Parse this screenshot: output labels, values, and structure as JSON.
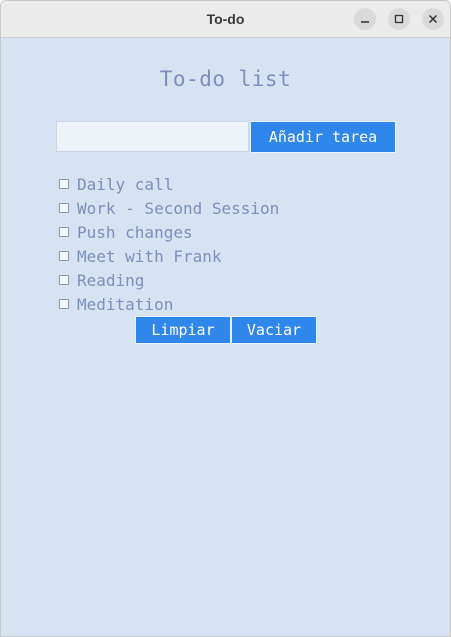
{
  "window": {
    "title": "To-do",
    "controls": [
      "minimize-icon",
      "maximize-icon",
      "close-icon"
    ]
  },
  "app": {
    "heading": "To-do list",
    "input": {
      "value": "",
      "placeholder": ""
    },
    "add_label": "Añadir tarea",
    "tasks": [
      {
        "label": "Daily call",
        "checked": false
      },
      {
        "label": "Work - Second Session",
        "checked": false
      },
      {
        "label": "Push changes",
        "checked": false
      },
      {
        "label": "Meet with Frank",
        "checked": false
      },
      {
        "label": "Reading",
        "checked": false
      },
      {
        "label": "Meditation",
        "checked": false
      }
    ],
    "clear_label": "Limpiar",
    "empty_label": "Vaciar"
  },
  "colors": {
    "background": "#d7e2f2",
    "accent": "#2f86eb",
    "text": "#7f8fbd"
  }
}
